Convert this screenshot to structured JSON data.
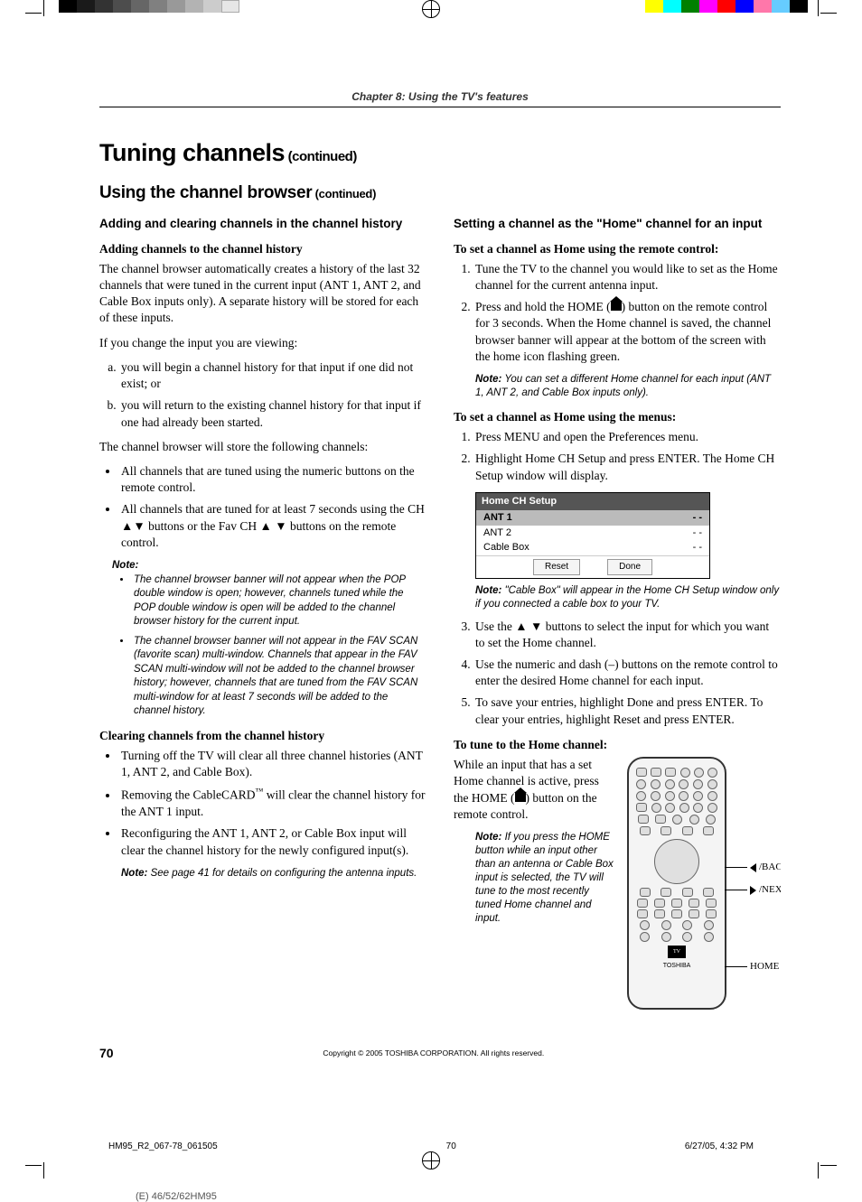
{
  "header": {
    "chapter": "Chapter 8: Using the TV's features"
  },
  "title": {
    "main": "Tuning channels",
    "cont": " (continued)"
  },
  "subtitle": {
    "main": "Using the channel browser",
    "cont": " (continued)"
  },
  "left": {
    "h3a": "Adding and clearing channels in the channel history",
    "h4a": "Adding channels to the channel history",
    "p1": "The channel browser automatically creates a history of the last 32 channels that were tuned in the current input (ANT 1, ANT 2, and Cable Box inputs only). A separate history will be stored for each of these inputs.",
    "p2": "If you change the input you are viewing:",
    "ol_a": "you will begin a channel history for that input if one did not exist; or",
    "ol_b": "you will return to the existing channel history for that input if one had already been started.",
    "p3": "The channel browser will store the following channels:",
    "ul1_a": "All channels that are tuned using the numeric buttons on the remote control.",
    "ul1_b": "All channels that are tuned for at least 7 seconds using the CH ▲▼ buttons or the Fav CH ▲ ▼ buttons on the remote control.",
    "note1_label": "Note:",
    "note1_a": "The channel browser banner will not appear when the POP double window is open; however, channels tuned while the POP double window is open will be added to the channel browser history for the current input.",
    "note1_b": "The channel browser banner will not appear in the FAV SCAN (favorite scan) multi-window. Channels that appear in the FAV SCAN multi-window will not be added to the channel browser history; however, channels that are tuned from the FAV SCAN multi-window for at least 7 seconds will be added to the channel history.",
    "h4b": "Clearing channels from the channel history",
    "ul2_a": "Turning off the TV will clear all three channel histories (ANT 1, ANT 2, and Cable Box).",
    "ul2_b_pre": "Removing the CableCARD",
    "ul2_b_post": " will clear the channel history for the ANT 1 input.",
    "ul2_c": "Reconfiguring the ANT 1, ANT 2, or Cable Box input will clear the channel history for the newly configured input(s).",
    "note2_label": "Note:",
    "note2": " See page 41 for details on configuring the antenna inputs."
  },
  "right": {
    "h3": "Setting a channel as the \"Home\" channel for an input",
    "h4a": "To set a channel as Home using the remote control:",
    "ol1_a": "Tune the TV to the channel you would like to set as the Home channel for the current antenna input.",
    "ol1_b_pre": "Press and hold the HOME (",
    "ol1_b_post": ") button on the remote control for 3 seconds. When the Home channel is saved, the channel browser banner will appear at the bottom of the screen with the home icon flashing green.",
    "inset1_label": "Note:",
    "inset1": " You can set a different Home channel for each input (ANT 1, ANT 2, and Cable Box inputs only).",
    "h4b": "To set a channel as Home using the menus:",
    "ol2_a": "Press MENU and open the Preferences menu.",
    "ol2_b": "Highlight Home CH Setup and press ENTER.  The Home CH Setup window will display.",
    "setup": {
      "title": "Home CH Setup",
      "rows": [
        {
          "k": "ANT 1",
          "v": "- -"
        },
        {
          "k": "ANT 2",
          "v": "- -"
        },
        {
          "k": "Cable Box",
          "v": "- -"
        }
      ],
      "reset": "Reset",
      "done": "Done"
    },
    "inset2_label": "Note:",
    "inset2": " \"Cable Box\" will appear in the Home CH Setup window only if you connected a cable box to your TV.",
    "ol2_c": "Use the ▲ ▼ buttons to select the input for which you want to set the Home channel.",
    "ol2_d": "Use the numeric and dash (–) buttons on the remote control to enter the desired Home channel for each input.",
    "ol2_e": "To save your entries, highlight Done and press ENTER. To clear your entries, highlight Reset and press ENTER.",
    "h4c": "To tune to the Home channel:",
    "p1_pre": "While an input that has a set Home channel is active, press the HOME (",
    "p1_post": ") button on the remote control.",
    "inset3_label": "Note:",
    "inset3": " If you press the HOME button while an input other than an antenna or Cable Box input is selected, the TV will tune to the most recently tuned Home channel and input.",
    "callouts": {
      "back": "/BACK",
      "next": "/NEXT",
      "home_pre": "HOME (",
      "home_post": ")"
    },
    "remote_brand": "TOSHIBA"
  },
  "footer": {
    "page": "70",
    "copyright": "Copyright © 2005 TOSHIBA CORPORATION. All rights reserved."
  },
  "slug": {
    "file": "HM95_R2_067-78_061505",
    "page": "70",
    "stamp": "6/27/05, 4:32 PM"
  },
  "model": "(E) 46/52/62HM95"
}
